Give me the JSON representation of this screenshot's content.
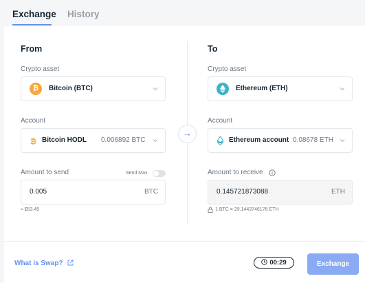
{
  "tabs": {
    "exchange": "Exchange",
    "history": "History"
  },
  "from": {
    "title": "From",
    "crypto_label": "Crypto asset",
    "crypto_value": "Bitcoin (BTC)",
    "coin_glyph": "₿",
    "coin_color": "#f7a838",
    "account_label": "Account",
    "account_name": "Bitcoin HODL",
    "account_balance": "0.006892 BTC",
    "amount_label": "Amount to send",
    "send_max_label": "Send Max",
    "amount_value": "0.005",
    "amount_unit": "BTC",
    "fiat_value": "≈ $53.45"
  },
  "to": {
    "title": "To",
    "crypto_label": "Crypto asset",
    "crypto_value": "Ethereum (ETH)",
    "coin_color": "#3ab5c7",
    "account_label": "Account",
    "account_name": "Ethereum account",
    "account_balance": "0.08678 ETH",
    "amount_label": "Amount to receive",
    "amount_value": "0.145721873088",
    "amount_unit": "ETH",
    "rate": "1 BTC = 29.1443746176 ETH"
  },
  "footer": {
    "what_is_swap": "What is Swap?",
    "timer": "00:29",
    "exchange_button": "Exchange"
  },
  "colors": {
    "accent": "#6490f1",
    "button": "#8aabf3"
  }
}
